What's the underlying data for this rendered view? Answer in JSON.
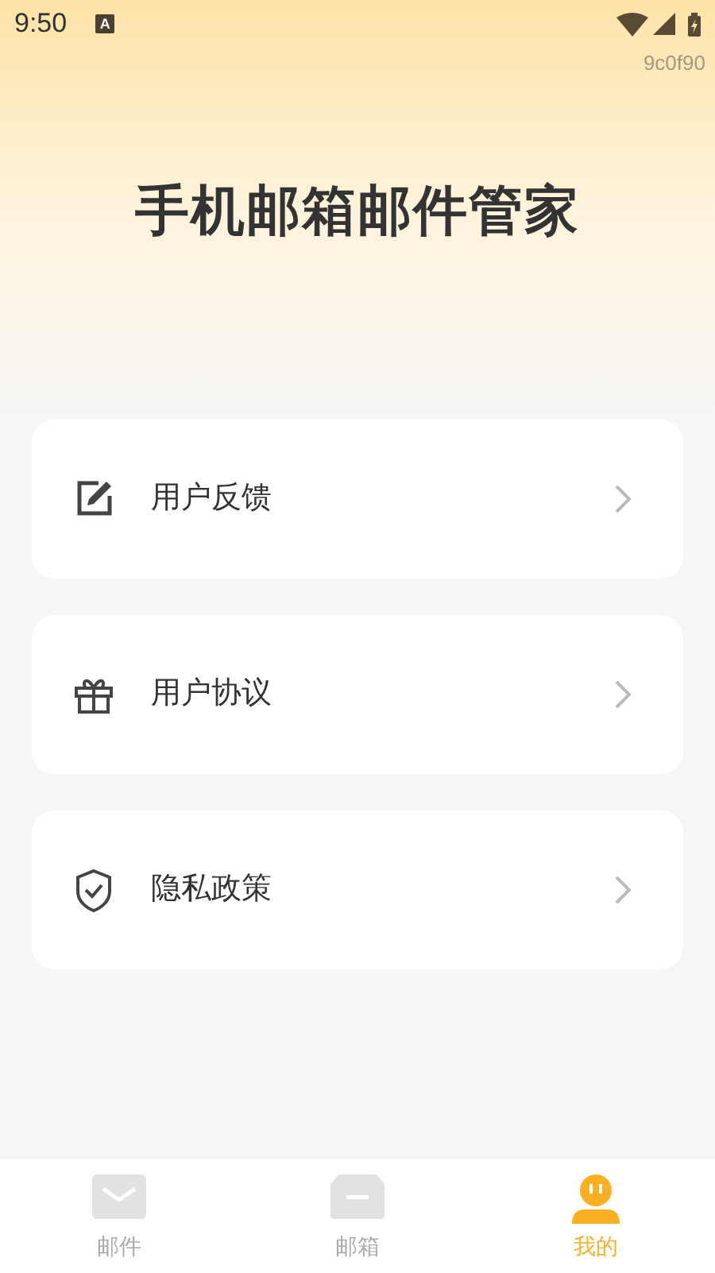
{
  "status_bar": {
    "time": "9:50",
    "notification": "A"
  },
  "build_tag": "9c0f90",
  "app_title": "手机邮箱邮件管家",
  "menu": [
    {
      "kind": "feedback",
      "label": "用户反馈"
    },
    {
      "kind": "agreement",
      "label": "用户协议"
    },
    {
      "kind": "privacy",
      "label": "隐私政策"
    }
  ],
  "tabs": [
    {
      "kind": "mail",
      "label": "邮件",
      "selected": false
    },
    {
      "kind": "mailbox",
      "label": "邮箱",
      "selected": false
    },
    {
      "kind": "me",
      "label": "我的",
      "selected": true
    }
  ]
}
